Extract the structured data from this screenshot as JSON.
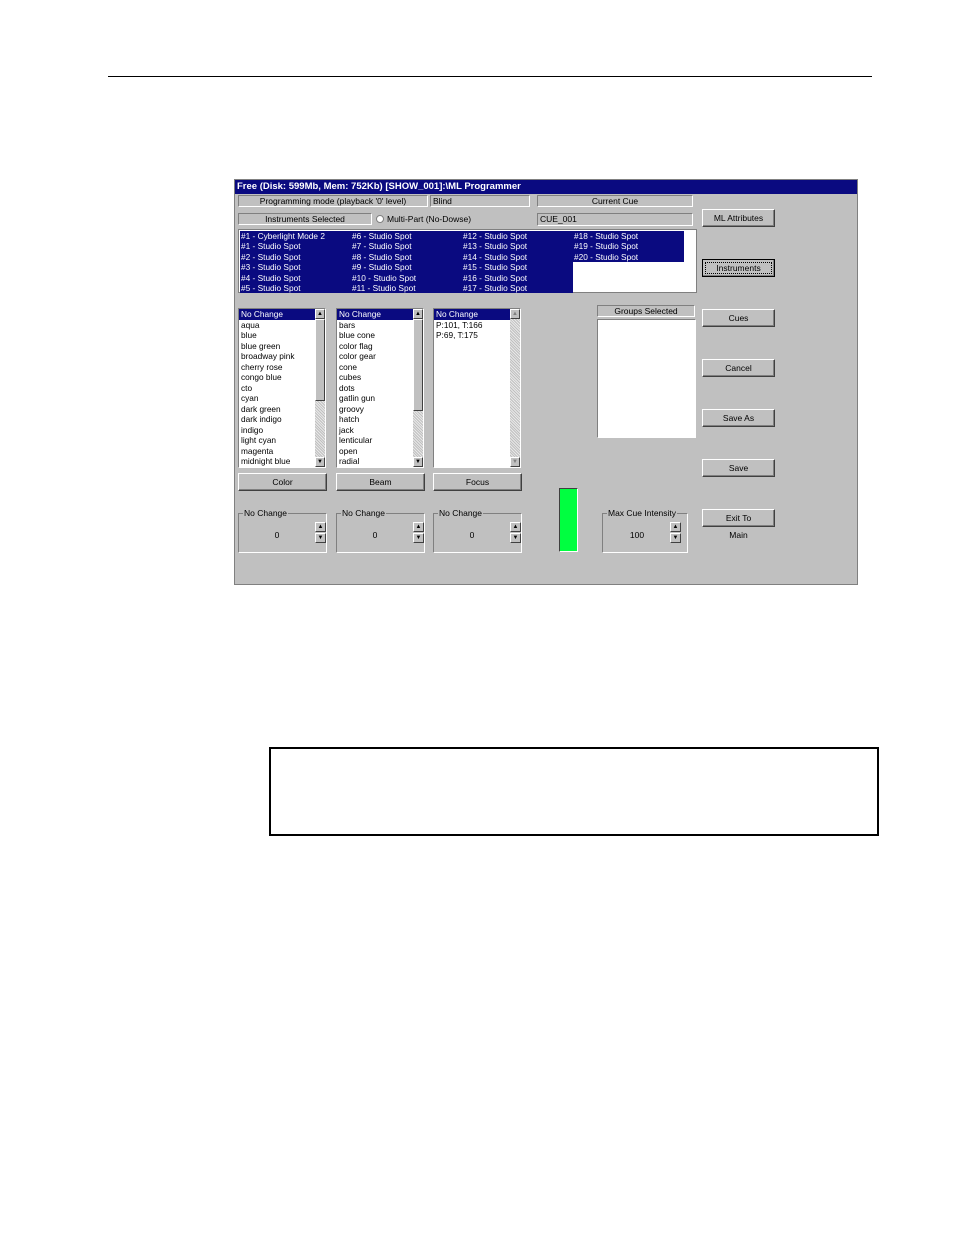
{
  "window": {
    "title": "Free (Disk: 599Mb, Mem: 752Kb)    [SHOW_001]:\\ML Programmer"
  },
  "header": {
    "programming_mode_label": "Programming mode (playback '0' level)",
    "mode_value": "Blind",
    "current_cue_label": "Current Cue",
    "current_cue_value": "CUE_001",
    "instruments_selected_label": "Instruments Selected",
    "multipart_label": "Multi-Part (No-Dowse)"
  },
  "instruments": {
    "col1": [
      "#1 - Cyberlight Mode 2",
      "#1 - Studio Spot",
      "#2 - Studio Spot",
      "#3 - Studio Spot",
      "#4 - Studio Spot",
      "#5 - Studio Spot"
    ],
    "col2": [
      "#6 - Studio Spot",
      "#7 - Studio Spot",
      "#8 - Studio Spot",
      "#9 - Studio Spot",
      "#10 - Studio Spot",
      "#11 - Studio Spot"
    ],
    "col3": [
      "#12 - Studio Spot",
      "#13 - Studio Spot",
      "#14 - Studio Spot",
      "#15 - Studio Spot",
      "#16 - Studio Spot",
      "#17 - Studio Spot"
    ],
    "col4": [
      "#18 - Studio Spot",
      "#19 - Studio Spot",
      "#20 - Studio Spot"
    ]
  },
  "lists": {
    "color": [
      "No Change",
      "aqua",
      "blue",
      "blue green",
      "broadway pink",
      "cherry rose",
      "congo blue",
      "cto",
      "cyan",
      "dark green",
      "dark indigo",
      "indigo",
      "light cyan",
      "magenta",
      "midnight blue"
    ],
    "beam": [
      "No Change",
      "bars",
      "blue cone",
      "color flag",
      "color gear",
      "cone",
      "cubes",
      "dots",
      "gatlin gun",
      "groovy",
      "hatch",
      "jack",
      "lenticular",
      "open",
      "radial"
    ],
    "focus": [
      "No Change",
      "P:101, T:166",
      "P:69, T:175"
    ]
  },
  "groups_selected_label": "Groups Selected",
  "list_buttons": {
    "color": "Color",
    "beam": "Beam",
    "focus": "Focus"
  },
  "spinners": {
    "color": {
      "label": "No Change",
      "value": "0"
    },
    "beam": {
      "label": "No Change",
      "value": "0"
    },
    "focus": {
      "label": "No Change",
      "value": "0"
    },
    "intensity": {
      "label": "Max Cue Intensity",
      "value": "100"
    }
  },
  "side_buttons": {
    "ml_attributes": "ML Attributes",
    "instruments": "Instruments",
    "cues": "Cues",
    "cancel": "Cancel",
    "save_as": "Save As",
    "save": "Save",
    "exit_to": "Exit To",
    "exit_target": "Main"
  },
  "colors": {
    "title_bar": "#0a0a80",
    "selection": "#0a0a80",
    "intensity_indicator": "#00ff40",
    "window_face": "#c0c0c0"
  }
}
